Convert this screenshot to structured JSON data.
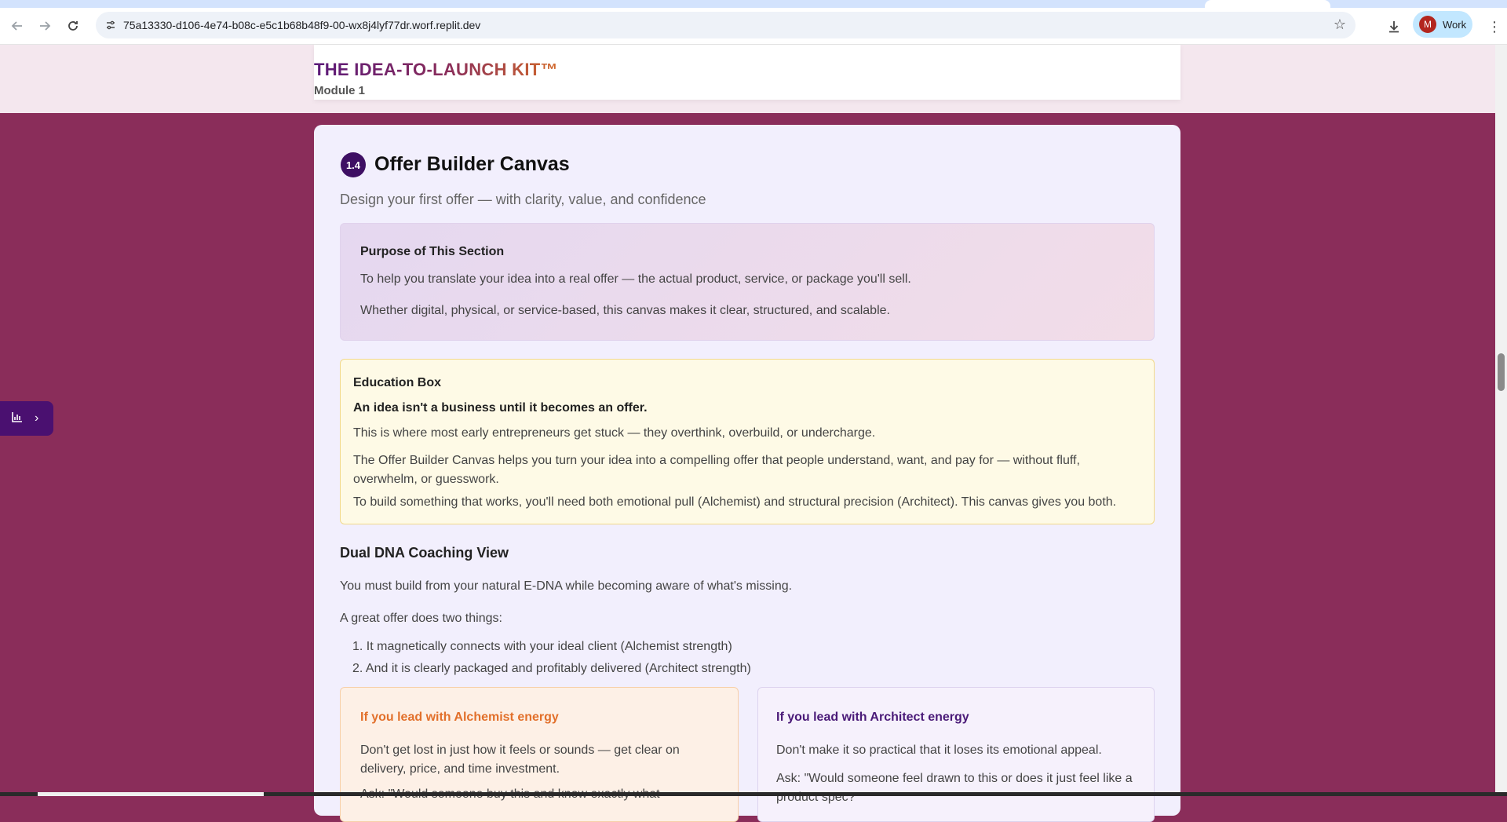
{
  "browser": {
    "url": "75a13330-d106-4e74-b08c-e5c1b68b48f9-00-wx8j4lyf77dr.worf.replit.dev",
    "profile_initial": "M",
    "profile_name": "Work"
  },
  "header": {
    "brand": "THE IDEA-TO-LAUNCH KIT™",
    "module": "Module 1"
  },
  "section": {
    "number": "1.4",
    "title": "Offer Builder Canvas",
    "subtitle": "Design your first offer — with clarity, value, and confidence"
  },
  "purpose": {
    "heading": "Purpose of This Section",
    "line1": "To help you translate your idea into a real offer — the actual product, service, or package you'll sell.",
    "line2": "Whether digital, physical, or service-based, this canvas makes it clear, structured, and scalable."
  },
  "education": {
    "heading": "Education Box",
    "lead": "An idea isn't a business until it becomes an offer.",
    "text1": "This is where most early entrepreneurs get stuck — they overthink, overbuild, or undercharge.",
    "text2": "The Offer Builder Canvas helps you turn your idea into a compelling offer that people understand, want, and pay for — without fluff, overwhelm, or guesswork.",
    "text3": "To build something that works, you'll need both emotional pull (Alchemist) and structural precision (Architect). This canvas gives you both."
  },
  "dna": {
    "heading": "Dual DNA Coaching View",
    "p1": "You must build from your natural E-DNA while becoming aware of what's missing.",
    "p2": "A great offer does two things:",
    "items": [
      "1. It magnetically connects with your ideal client (Alchemist strength)",
      "2. And it is clearly packaged and profitably delivered (Architect strength)"
    ]
  },
  "alchemist": {
    "heading": "If you lead with Alchemist energy",
    "p": "Don't get lost in just how it feels or sounds — get clear on delivery, price, and time investment.",
    "p2": "Ask: \"Would someone buy this and know exactly what"
  },
  "architect": {
    "heading": "If you lead with Architect energy",
    "p": "Don't make it so practical that it loses its emotional appeal.",
    "p2": "Ask: \"Would someone feel drawn to this or does it just feel like a product spec?\""
  },
  "colors": {
    "page_bg": "#8a2d5a",
    "badge": "#3e0f63",
    "alchemist_accent": "#e2702b",
    "architect_accent": "#4a1a78"
  }
}
